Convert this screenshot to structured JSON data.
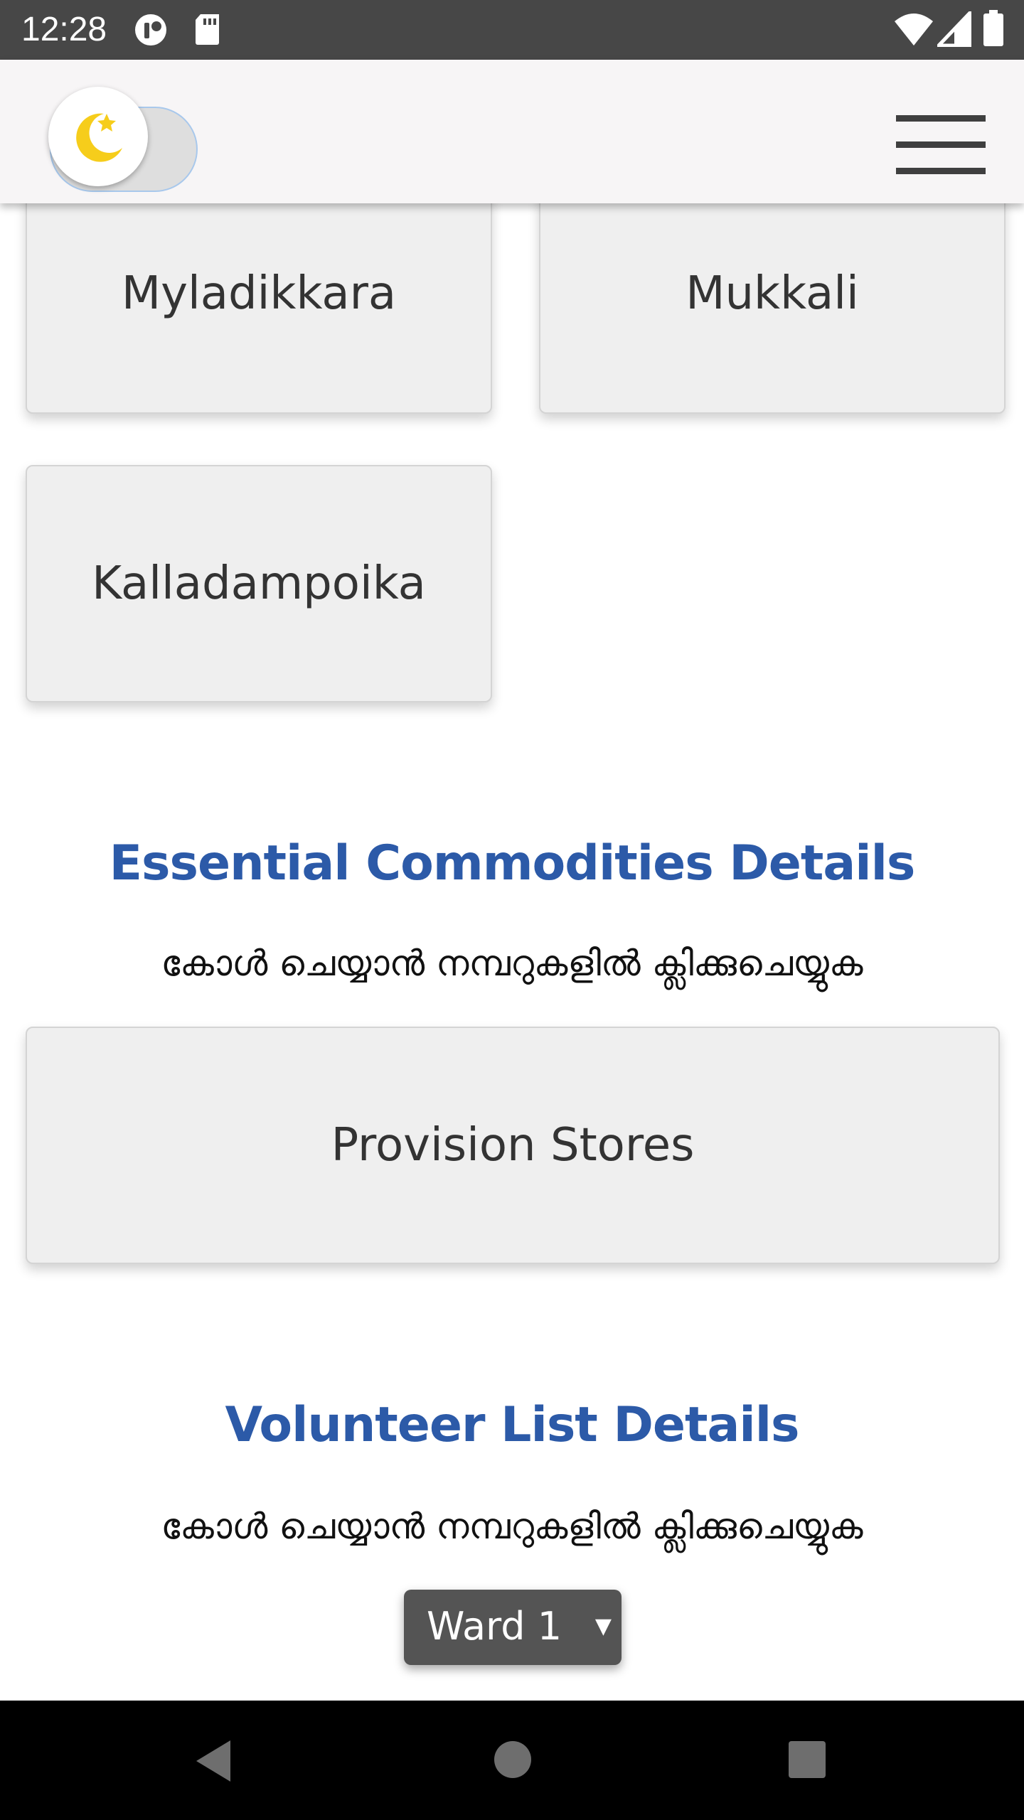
{
  "status_bar": {
    "time": "12:28",
    "icons": [
      "notification-app-icon",
      "sd-card-icon",
      "wifi-icon",
      "signal-icon",
      "battery-icon"
    ]
  },
  "app_bar": {
    "theme_toggle_icon": "moon-star-icon",
    "menu_icon": "hamburger-menu-icon"
  },
  "places": {
    "cards": [
      "Myladikkara",
      "Mukkali",
      "Kalladampoika"
    ]
  },
  "essential_commodities": {
    "title": "Essential Commodities Details",
    "subtitle": "കോൾ ചെയ്യാൻ നമ്പറുകളിൽ ക്ലിക്കുചെയ്യുക",
    "cards": [
      "Provision Stores"
    ]
  },
  "volunteer_list": {
    "title": "Volunteer List Details",
    "subtitle": "കോൾ ചെയ്യാൻ നമ്പറുകളിൽ ക്ലിക്കുചെയ്യുക",
    "ward_select": {
      "value": "Ward 1",
      "caret": "▼"
    }
  },
  "colors": {
    "accent": "#2c5aa8",
    "status_bar": "#474747",
    "app_bar": "#f7f5f6",
    "card_bg": "#efefef",
    "moon": "#f6cd1b"
  },
  "nav_bar": {
    "icons": [
      "back-icon",
      "home-icon",
      "recents-icon"
    ]
  }
}
